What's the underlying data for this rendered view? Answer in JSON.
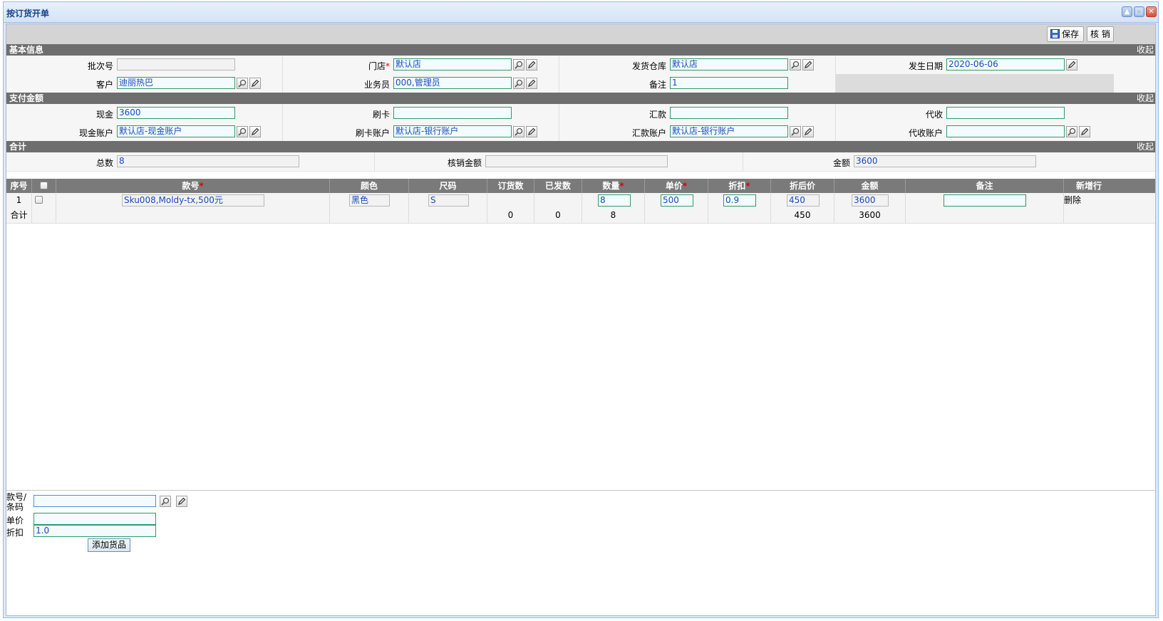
{
  "window": {
    "title": "按订货开单"
  },
  "toolbar": {
    "save_label": "保存",
    "verify_label": "核 销"
  },
  "basic_info": {
    "header": "基本信息",
    "collapse": "收起",
    "batch_label": "批次号",
    "batch_value": "",
    "store_label": "门店",
    "store_value": "默认店",
    "warehouse_label": "发货仓库",
    "warehouse_value": "默认店",
    "date_label": "发生日期",
    "date_value": "2020-06-06",
    "customer_label": "客户",
    "customer_value": "迪丽热巴",
    "salesman_label": "业务员",
    "salesman_value": "000,管理员",
    "remark_label": "备注",
    "remark_value": "1"
  },
  "payment": {
    "header": "支付金额",
    "collapse": "收起",
    "cash_label": "现金",
    "cash_value": "3600",
    "card_label": "刷卡",
    "card_value": "",
    "remit_label": "汇款",
    "remit_value": "",
    "collect_label": "代收",
    "collect_value": "",
    "cash_account_label": "现金账户",
    "cash_account_value": "默认店-现金账户",
    "card_account_label": "刷卡账户",
    "card_account_value": "默认店-银行账户",
    "remit_account_label": "汇款账户",
    "remit_account_value": "默认店-银行账户",
    "collect_account_label": "代收账户",
    "collect_account_value": ""
  },
  "summary": {
    "header": "合计",
    "collapse": "收起",
    "total_count_label": "总数",
    "total_count_value": "8",
    "verify_amount_label": "核销金额",
    "verify_amount_value": "",
    "amount_label": "金额",
    "amount_value": "3600"
  },
  "grid": {
    "columns": {
      "seq": "序号",
      "style": "款号",
      "color": "颜色",
      "size": "尺码",
      "ordered": "订货数",
      "shipped": "已发数",
      "qty": "数量",
      "price": "单价",
      "discount": "折扣",
      "net_price": "折后价",
      "amount": "金额",
      "remark": "备注",
      "new_row": "新增行"
    },
    "row": {
      "seq": "1",
      "style": "Sku008,Moldy-tx,500元",
      "color": "黑色",
      "size": "S",
      "ordered": "",
      "shipped": "",
      "qty": "8",
      "price": "500",
      "discount": "0.9",
      "net_price": "450",
      "amount": "3600",
      "remark": "",
      "action": "删除"
    },
    "total": {
      "label": "合计",
      "ordered": "0",
      "shipped": "0",
      "qty": "8",
      "net_price": "450",
      "amount": "3600"
    }
  },
  "add_item": {
    "code_label": "款号/条码",
    "code_value": "",
    "price_label": "单价",
    "price_value": "",
    "discount_label": "折扣",
    "discount_value": "1.0",
    "add_button": "添加货品"
  }
}
